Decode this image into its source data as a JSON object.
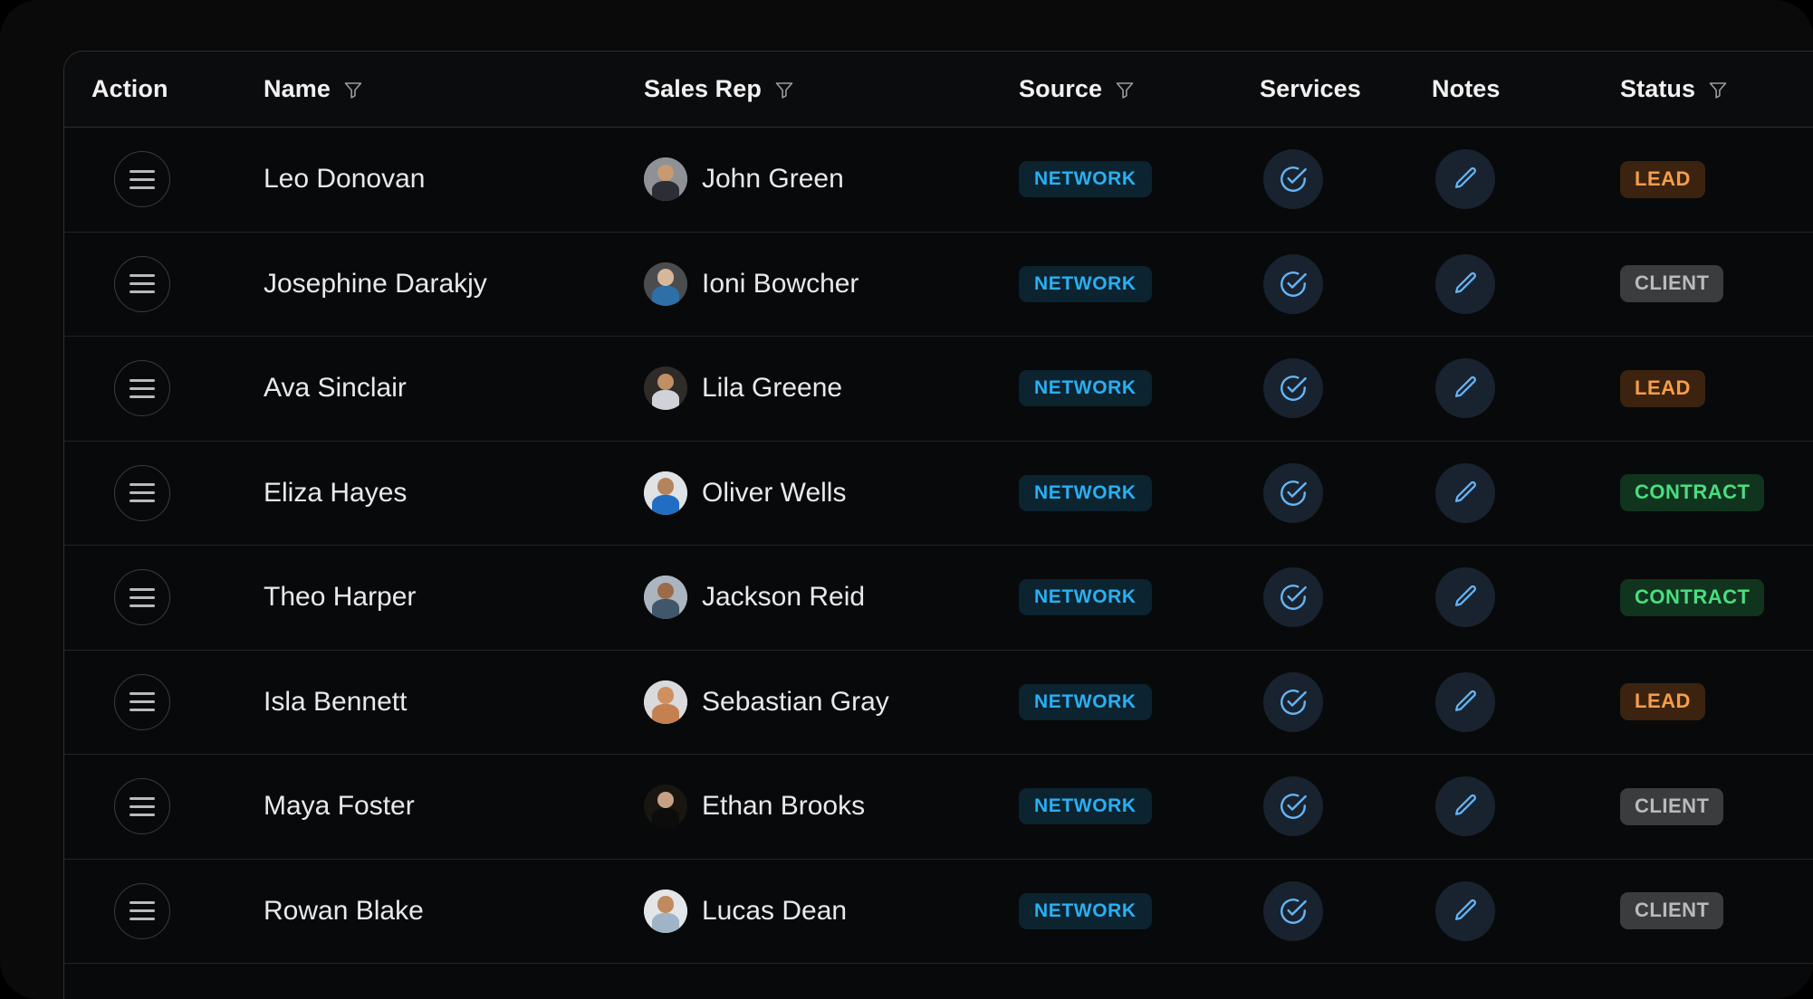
{
  "table": {
    "columns": [
      {
        "key": "action",
        "label": "Action",
        "filterable": false
      },
      {
        "key": "name",
        "label": "Name",
        "filterable": true
      },
      {
        "key": "rep",
        "label": "Sales Rep",
        "filterable": true
      },
      {
        "key": "source",
        "label": "Source",
        "filterable": true
      },
      {
        "key": "services",
        "label": "Services",
        "filterable": false
      },
      {
        "key": "notes",
        "label": "Notes",
        "filterable": false
      },
      {
        "key": "status",
        "label": "Status",
        "filterable": true
      }
    ],
    "icons": {
      "filter": "filter-funnel-icon",
      "action": "hamburger-menu-icon",
      "services": "check-circle-icon",
      "notes": "pencil-edit-icon"
    },
    "rows": [
      {
        "name": "Leo Donovan",
        "rep": "John Green",
        "source": "NETWORK",
        "services": "check-circle-icon",
        "notes": "pencil-edit-icon",
        "status": "LEAD",
        "status_kind": "lead",
        "avatar_colors": {
          "bg": "#8e9196",
          "skin": "#c99a72",
          "cloth": "#2b2f35"
        }
      },
      {
        "name": "Josephine Darakjy",
        "rep": "Ioni Bowcher",
        "source": "NETWORK",
        "services": "check-circle-icon",
        "notes": "pencil-edit-icon",
        "status": "CLIENT",
        "status_kind": "client",
        "avatar_colors": {
          "bg": "#4b4c4e",
          "skin": "#d7b79a",
          "cloth": "#2f6fa8"
        }
      },
      {
        "name": "Ava Sinclair",
        "rep": "Lila Greene",
        "source": "NETWORK",
        "services": "check-circle-icon",
        "notes": "pencil-edit-icon",
        "status": "LEAD",
        "status_kind": "lead",
        "avatar_colors": {
          "bg": "#2e2b29",
          "skin": "#c08f63",
          "cloth": "#cfd3d8"
        }
      },
      {
        "name": "Eliza Hayes",
        "rep": "Oliver Wells",
        "source": "NETWORK",
        "services": "check-circle-icon",
        "notes": "pencil-edit-icon",
        "status": "CONTRACT",
        "status_kind": "contract",
        "avatar_colors": {
          "bg": "#dfe3e6",
          "skin": "#b5835c",
          "cloth": "#1f6ec4"
        }
      },
      {
        "name": "Theo Harper",
        "rep": "Jackson Reid",
        "source": "NETWORK",
        "services": "check-circle-icon",
        "notes": "pencil-edit-icon",
        "status": "CONTRACT",
        "status_kind": "contract",
        "avatar_colors": {
          "bg": "#aab5c0",
          "skin": "#9c6b49",
          "cloth": "#40566b"
        }
      },
      {
        "name": "Isla Bennett",
        "rep": "Sebastian Gray",
        "source": "NETWORK",
        "services": "check-circle-icon",
        "notes": "pencil-edit-icon",
        "status": "LEAD",
        "status_kind": "lead",
        "avatar_colors": {
          "bg": "#d9dade",
          "skin": "#d08f5e",
          "cloth": "#c4814f"
        }
      },
      {
        "name": "Maya Foster",
        "rep": "Ethan Brooks",
        "source": "NETWORK",
        "services": "check-circle-icon",
        "notes": "pencil-edit-icon",
        "status": "CLIENT",
        "status_kind": "client",
        "avatar_colors": {
          "bg": "#191612",
          "skin": "#c8a184",
          "cloth": "#0c0c0d"
        }
      },
      {
        "name": "Rowan Blake",
        "rep": "Lucas Dean",
        "source": "NETWORK",
        "services": "check-circle-icon",
        "notes": "pencil-edit-icon",
        "status": "CLIENT",
        "status_kind": "client",
        "avatar_colors": {
          "bg": "#e3e6e9",
          "skin": "#c08a5e",
          "cloth": "#9fb4c6"
        }
      }
    ]
  },
  "colors": {
    "page_background": "#000000",
    "panel_background": "#0a0a0b",
    "table_background": "#08090a",
    "row_divider": "#222426",
    "header_divider": "#2b2d30",
    "text_primary": "#e8e9ea",
    "badge_network_bg": "#0c2330",
    "badge_network_text": "#29b0f3",
    "badge_lead_bg": "#3c2310",
    "badge_lead_text": "#f79e49",
    "badge_client_bg": "#3b3c3e",
    "badge_client_text": "#b9babc",
    "badge_contract_bg": "#11341f",
    "badge_contract_text": "#4ade80",
    "icon_button_bg": "#19232f",
    "icon_accent": "#64b5f6"
  }
}
